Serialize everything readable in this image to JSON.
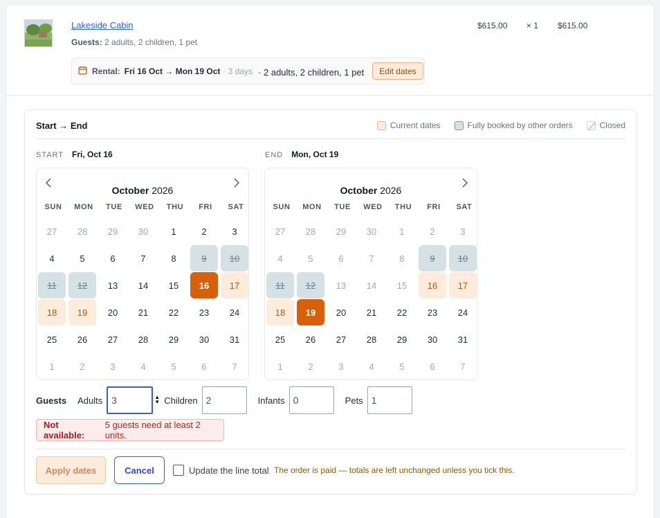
{
  "line_item": {
    "product_name": "Lakeside Cabin",
    "guests_label": "Guests:",
    "guests_value": "2 adults, 2 children, 1 pet",
    "unit_price": "$615.00",
    "quantity": "× 1",
    "total": "$615.00",
    "rental_label": "Rental:",
    "rental_dates": "Fri 16 Oct → Mon 19 Oct",
    "rental_nights": "· 3 days",
    "rental_party": "· 2 adults, 2 children, 1 pet",
    "edit_dates_label": "Edit dates"
  },
  "picker": {
    "title": "Start → End",
    "legend": {
      "current": "Current dates",
      "booked": "Fully booked by other orders",
      "closed": "Closed"
    },
    "start": {
      "label": "START",
      "value": "Fri, Oct 16"
    },
    "end": {
      "label": "END",
      "value": "Mon, Oct 19"
    },
    "weekdays": [
      "SUN",
      "MON",
      "TUE",
      "WED",
      "THU",
      "FRI",
      "SAT"
    ],
    "calendars": [
      {
        "month": "October",
        "year": "2026",
        "has_prev": true,
        "has_next": true,
        "weeks": [
          [
            {
              "d": "27",
              "s": "muted"
            },
            {
              "d": "28",
              "s": "muted"
            },
            {
              "d": "29",
              "s": "muted"
            },
            {
              "d": "30",
              "s": "muted"
            },
            {
              "d": "1",
              "s": ""
            },
            {
              "d": "2",
              "s": ""
            },
            {
              "d": "3",
              "s": ""
            }
          ],
          [
            {
              "d": "4",
              "s": ""
            },
            {
              "d": "5",
              "s": ""
            },
            {
              "d": "6",
              "s": ""
            },
            {
              "d": "7",
              "s": ""
            },
            {
              "d": "8",
              "s": ""
            },
            {
              "d": "9",
              "s": "booked"
            },
            {
              "d": "10",
              "s": "booked"
            }
          ],
          [
            {
              "d": "11",
              "s": "booked"
            },
            {
              "d": "12",
              "s": "booked"
            },
            {
              "d": "13",
              "s": ""
            },
            {
              "d": "14",
              "s": ""
            },
            {
              "d": "15",
              "s": ""
            },
            {
              "d": "16",
              "s": "sel"
            },
            {
              "d": "17",
              "s": "current"
            }
          ],
          [
            {
              "d": "18",
              "s": "current"
            },
            {
              "d": "19",
              "s": "current"
            },
            {
              "d": "20",
              "s": ""
            },
            {
              "d": "21",
              "s": ""
            },
            {
              "d": "22",
              "s": ""
            },
            {
              "d": "23",
              "s": ""
            },
            {
              "d": "24",
              "s": ""
            }
          ],
          [
            {
              "d": "25",
              "s": ""
            },
            {
              "d": "26",
              "s": ""
            },
            {
              "d": "27",
              "s": ""
            },
            {
              "d": "28",
              "s": ""
            },
            {
              "d": "29",
              "s": ""
            },
            {
              "d": "30",
              "s": ""
            },
            {
              "d": "31",
              "s": ""
            }
          ],
          [
            {
              "d": "1",
              "s": "muted"
            },
            {
              "d": "2",
              "s": "muted"
            },
            {
              "d": "3",
              "s": "muted"
            },
            {
              "d": "4",
              "s": "muted"
            },
            {
              "d": "5",
              "s": "muted"
            },
            {
              "d": "6",
              "s": "muted"
            },
            {
              "d": "7",
              "s": "muted"
            }
          ]
        ]
      },
      {
        "month": "October",
        "year": "2026",
        "has_prev": false,
        "has_next": true,
        "weeks": [
          [
            {
              "d": "27",
              "s": "muted"
            },
            {
              "d": "28",
              "s": "muted"
            },
            {
              "d": "29",
              "s": "muted"
            },
            {
              "d": "30",
              "s": "muted"
            },
            {
              "d": "1",
              "s": "muted"
            },
            {
              "d": "2",
              "s": "muted"
            },
            {
              "d": "3",
              "s": "muted"
            }
          ],
          [
            {
              "d": "4",
              "s": "muted"
            },
            {
              "d": "5",
              "s": "muted"
            },
            {
              "d": "6",
              "s": "muted"
            },
            {
              "d": "7",
              "s": "muted"
            },
            {
              "d": "8",
              "s": "muted"
            },
            {
              "d": "9",
              "s": "booked"
            },
            {
              "d": "10",
              "s": "booked"
            }
          ],
          [
            {
              "d": "11",
              "s": "booked"
            },
            {
              "d": "12",
              "s": "booked"
            },
            {
              "d": "13",
              "s": "muted"
            },
            {
              "d": "14",
              "s": "muted"
            },
            {
              "d": "15",
              "s": "muted"
            },
            {
              "d": "16",
              "s": "current"
            },
            {
              "d": "17",
              "s": "current"
            }
          ],
          [
            {
              "d": "18",
              "s": "current"
            },
            {
              "d": "19",
              "s": "sel"
            },
            {
              "d": "20",
              "s": ""
            },
            {
              "d": "21",
              "s": ""
            },
            {
              "d": "22",
              "s": ""
            },
            {
              "d": "23",
              "s": ""
            },
            {
              "d": "24",
              "s": ""
            }
          ],
          [
            {
              "d": "25",
              "s": ""
            },
            {
              "d": "26",
              "s": ""
            },
            {
              "d": "27",
              "s": ""
            },
            {
              "d": "28",
              "s": ""
            },
            {
              "d": "29",
              "s": ""
            },
            {
              "d": "30",
              "s": ""
            },
            {
              "d": "31",
              "s": ""
            }
          ],
          [
            {
              "d": "1",
              "s": "muted"
            },
            {
              "d": "2",
              "s": "muted"
            },
            {
              "d": "3",
              "s": "muted"
            },
            {
              "d": "4",
              "s": "muted"
            },
            {
              "d": "5",
              "s": "muted"
            },
            {
              "d": "6",
              "s": "muted"
            },
            {
              "d": "7",
              "s": "muted"
            }
          ]
        ]
      }
    ],
    "guests": {
      "label": "Guests",
      "adults_label": "Adults",
      "adults_value": "3",
      "children_label": "Children",
      "children_value": "2",
      "infants_label": "Infants",
      "infants_value": "0",
      "pets_label": "Pets",
      "pets_value": "1"
    },
    "error": {
      "title": "Not available:",
      "message": "5 guests need at least 2 units."
    },
    "apply_label": "Apply dates",
    "cancel_label": "Cancel",
    "update_total_label": "Update the line total",
    "paid_note": "The order is paid — totals are left unchanged unless you tick this."
  },
  "colors": {
    "accent": "#d9600b",
    "current_bg": "#fdecdc",
    "booked_bg": "#d6e1e5",
    "link": "#2563eb",
    "focus": "#3b5bdb"
  }
}
